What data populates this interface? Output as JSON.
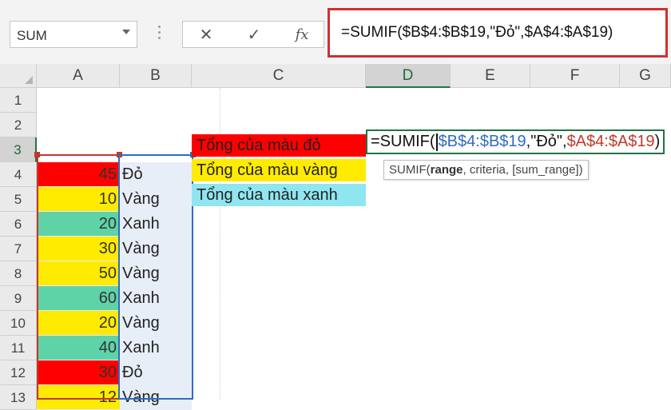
{
  "namebox": {
    "value": "SUM"
  },
  "formula_bar": {
    "cancel_symbol": "✕",
    "enter_symbol": "✓",
    "fx_symbol": "fx",
    "text": "=SUMIF($B$4:$B$19,\"Đỏ\",$A$4:$A$19)"
  },
  "columns": [
    "A",
    "B",
    "C",
    "D",
    "E",
    "F",
    "G"
  ],
  "selected_column": "D",
  "rows": [
    "1",
    "2",
    "3",
    "4",
    "5",
    "6",
    "7",
    "8",
    "9",
    "10",
    "11",
    "12",
    "13"
  ],
  "selected_row": "3",
  "data_rows": [
    {
      "a": "45",
      "b": "Đỏ",
      "color": "#ff0000"
    },
    {
      "a": "10",
      "b": "Vàng",
      "color": "#ffeb00"
    },
    {
      "a": "20",
      "b": "Xanh",
      "color": "#5fd3a8"
    },
    {
      "a": "30",
      "b": "Vàng",
      "color": "#ffeb00"
    },
    {
      "a": "50",
      "b": "Vàng",
      "color": "#ffeb00"
    },
    {
      "a": "60",
      "b": "Xanh",
      "color": "#5fd3a8"
    },
    {
      "a": "20",
      "b": "Vàng",
      "color": "#ffeb00"
    },
    {
      "a": "40",
      "b": "Xanh",
      "color": "#5fd3a8"
    },
    {
      "a": "30",
      "b": "Đỏ",
      "color": "#ff0000"
    },
    {
      "a": "12",
      "b": "Vàng",
      "color": "#ffeb00"
    }
  ],
  "labels": [
    {
      "text": "Tổng của màu đỏ",
      "color": "#ff0000"
    },
    {
      "text": "Tổng của màu vàng",
      "color": "#ffeb00"
    },
    {
      "text": "Tổng của màu xanh",
      "color": "#8fe6f0"
    }
  ],
  "editing_cell": {
    "prefix": "=SUMIF(",
    "range1": "$B$4:$B$19",
    "sep1": ",\"Đỏ\",",
    "range2": "$A$4:$A$19",
    "suffix": ")"
  },
  "tooltip": {
    "fn": "SUMIF(",
    "arg_active": "range",
    "rest": ", criteria, [sum_range])"
  }
}
